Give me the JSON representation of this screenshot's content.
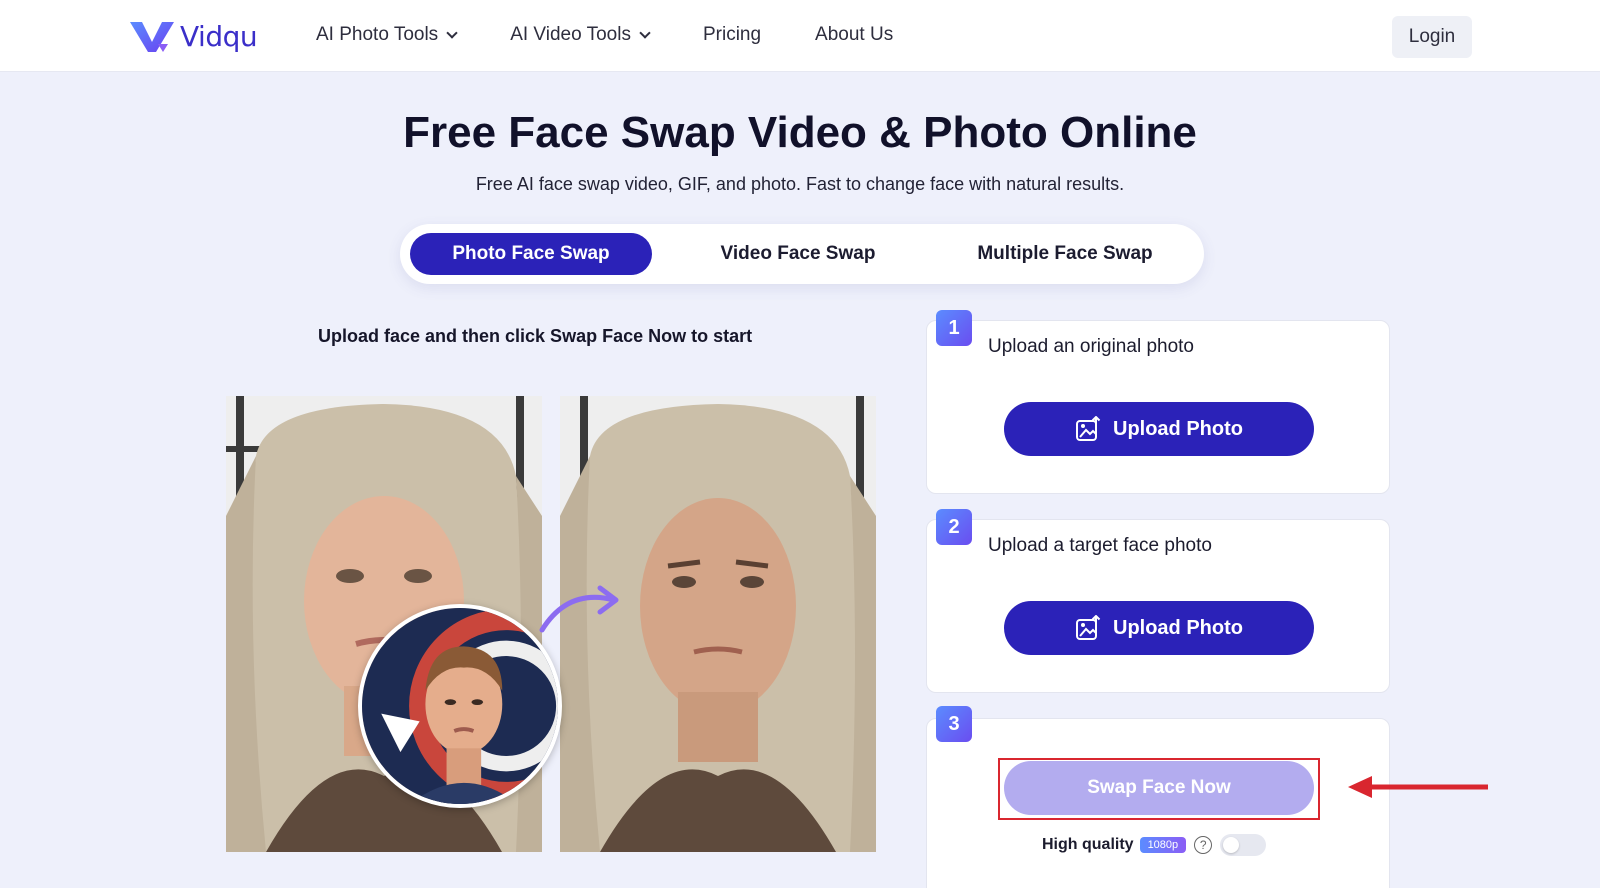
{
  "brand": {
    "name": "Vidqu"
  },
  "nav": {
    "items": [
      {
        "label": "AI Photo Tools",
        "has_dropdown": true
      },
      {
        "label": "AI Video Tools",
        "has_dropdown": true
      },
      {
        "label": "Pricing",
        "has_dropdown": false
      },
      {
        "label": "About Us",
        "has_dropdown": false
      }
    ],
    "login_label": "Login"
  },
  "hero": {
    "title": "Free Face Swap Video & Photo Online",
    "subtitle": "Free AI face swap video, GIF, and photo. Fast to change face with natural results."
  },
  "tabs": [
    {
      "label": "Photo Face Swap",
      "active": true
    },
    {
      "label": "Video Face Swap",
      "active": false
    },
    {
      "label": "Multiple Face Swap",
      "active": false
    }
  ],
  "main": {
    "instruction": "Upload face and then click Swap Face Now to start"
  },
  "steps": [
    {
      "number": "1",
      "label": "Upload an original photo",
      "button_label": "Upload Photo"
    },
    {
      "number": "2",
      "label": "Upload a target face photo",
      "button_label": "Upload Photo"
    },
    {
      "number": "3",
      "label": "",
      "button_label": "Swap Face Now"
    }
  ],
  "quality": {
    "label": "High quality",
    "badge": "1080p",
    "help": "?",
    "enabled": false
  },
  "colors": {
    "primary": "#2b22b8",
    "primary_disabled": "#b3acef",
    "background": "#eef0fb",
    "highlight": "#d9262f"
  }
}
